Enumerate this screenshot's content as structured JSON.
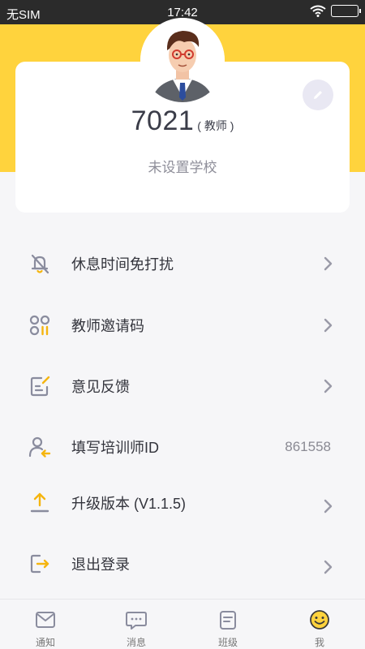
{
  "status_bar": {
    "carrier": "无SIM",
    "time": "17:42"
  },
  "profile": {
    "name": "7021",
    "role": "( 教师 )",
    "school": "未设置学校"
  },
  "menu": [
    {
      "label": "休息时间免打扰",
      "icon": "bell-off-icon",
      "value": ""
    },
    {
      "label": "教师邀请码",
      "icon": "grid-dots-icon",
      "value": ""
    },
    {
      "label": "意见反馈",
      "icon": "feedback-edit-icon",
      "value": ""
    },
    {
      "label": "填写培训师ID",
      "icon": "user-arrow-icon",
      "value": "861558"
    },
    {
      "label": "升级版本 (V1.1.5)",
      "icon": "upload-icon",
      "value": ""
    },
    {
      "label": "退出登录",
      "icon": "logout-icon",
      "value": ""
    }
  ],
  "tabs": [
    {
      "label": "通知",
      "icon": "mail-icon"
    },
    {
      "label": "消息",
      "icon": "chat-icon"
    },
    {
      "label": "班级",
      "icon": "class-doc-icon"
    },
    {
      "label": "我",
      "icon": "smiley-icon",
      "active": true
    }
  ],
  "colors": {
    "accent": "#ffd33d",
    "icon_gray": "#8a8c9e",
    "icon_yellow": "#f5b50f",
    "text": "#33343c"
  }
}
